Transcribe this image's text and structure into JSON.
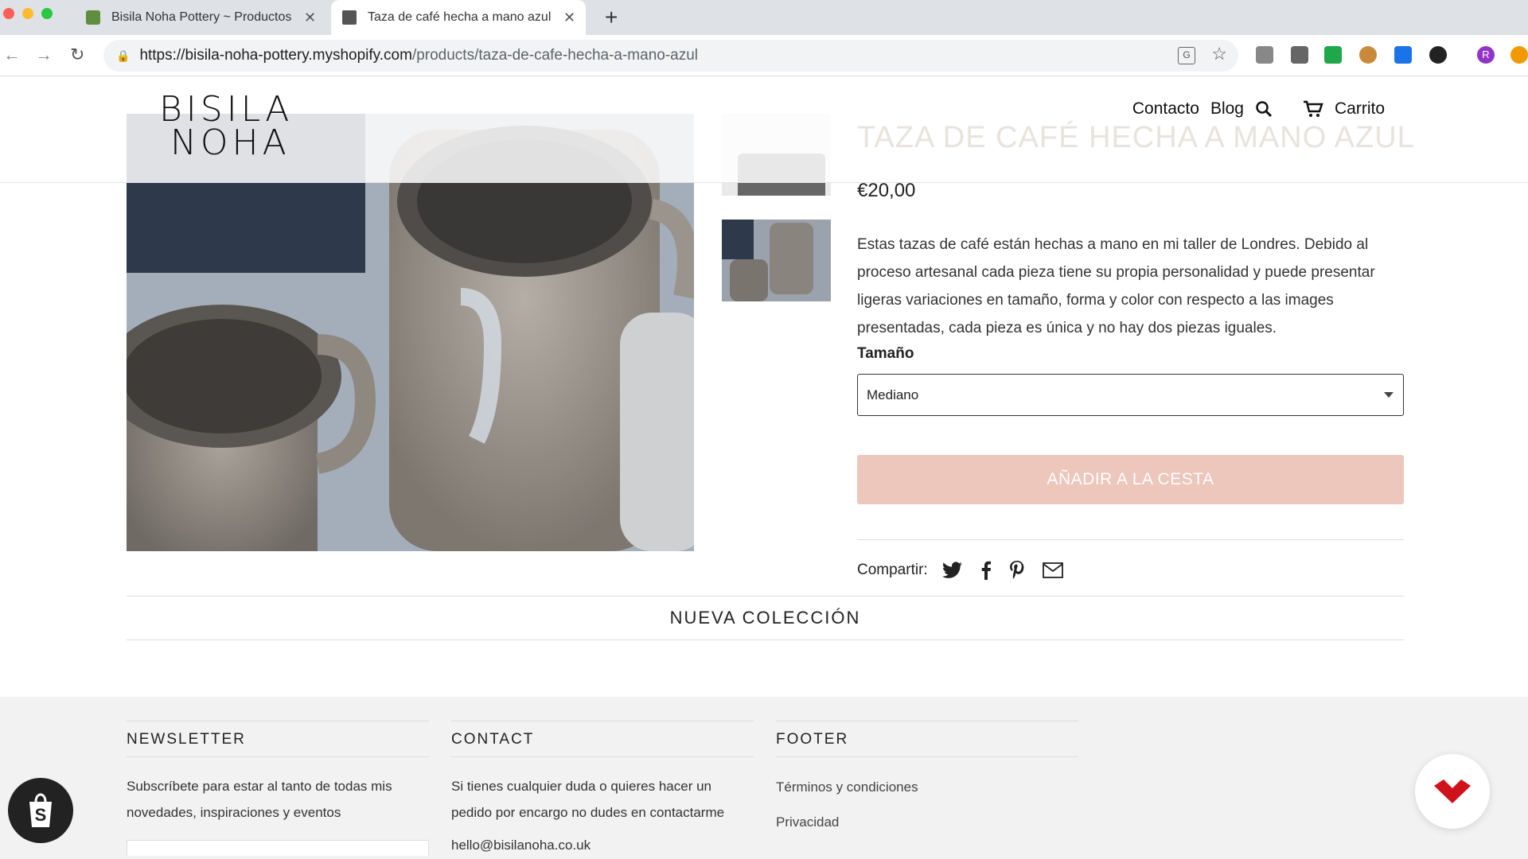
{
  "browser": {
    "tabs": [
      {
        "title": "Bisila Noha Pottery ~ Productos",
        "active": false
      },
      {
        "title": "Taza de café hecha a mano azul",
        "active": true
      }
    ],
    "url_host": "https://bisila-noha-pottery.myshopify.com",
    "url_path": "/products/taza-de-cafe-hecha-a-mano-azul",
    "profile_initial": "R"
  },
  "site": {
    "logo_line1": "BISILA",
    "logo_line2": "NOHA",
    "nav": {
      "contact": "Contacto",
      "blog": "Blog",
      "cart": "Carrito"
    }
  },
  "product": {
    "title": "TAZA DE CAFÉ HECHA A MANO AZUL",
    "price": "€20,00",
    "description": "Estas tazas de café están hechas a mano en mi taller de Londres. Debido al proceso artesanal cada pieza tiene su propia personalidad y puede presentar ligeras variaciones en tamaño, forma y color con respecto a las images presentadas, cada pieza es única y no hay dos piezas iguales.",
    "size_label": "Tamaño",
    "size_value": "Mediano",
    "add_to_cart": "AÑADIR A LA CESTA",
    "share_label": "Compartir:",
    "share_icons": [
      "twitter-icon",
      "facebook-icon",
      "pinterest-icon",
      "mail-icon"
    ]
  },
  "collection_heading": "NUEVA COLECCIÓN",
  "footer": {
    "newsletter": {
      "heading": "NEWSLETTER",
      "text": "Subscríbete para estar al tanto de todas mis novedades, inspiraciones y eventos"
    },
    "contact": {
      "heading": "CONTACT",
      "text": "Si tienes cualquier duda o quieres hacer un pedido por encargo no dudes en contactarme",
      "email": "hello@bisilanoha.co.uk"
    },
    "links": {
      "heading": "FOOTER",
      "items": [
        "Términos y condiciones",
        "Privacidad"
      ]
    }
  },
  "colors": {
    "accent_button": "#edc6bc",
    "footer_bg": "#f2f2f2",
    "help_badge": "#d0121b"
  }
}
